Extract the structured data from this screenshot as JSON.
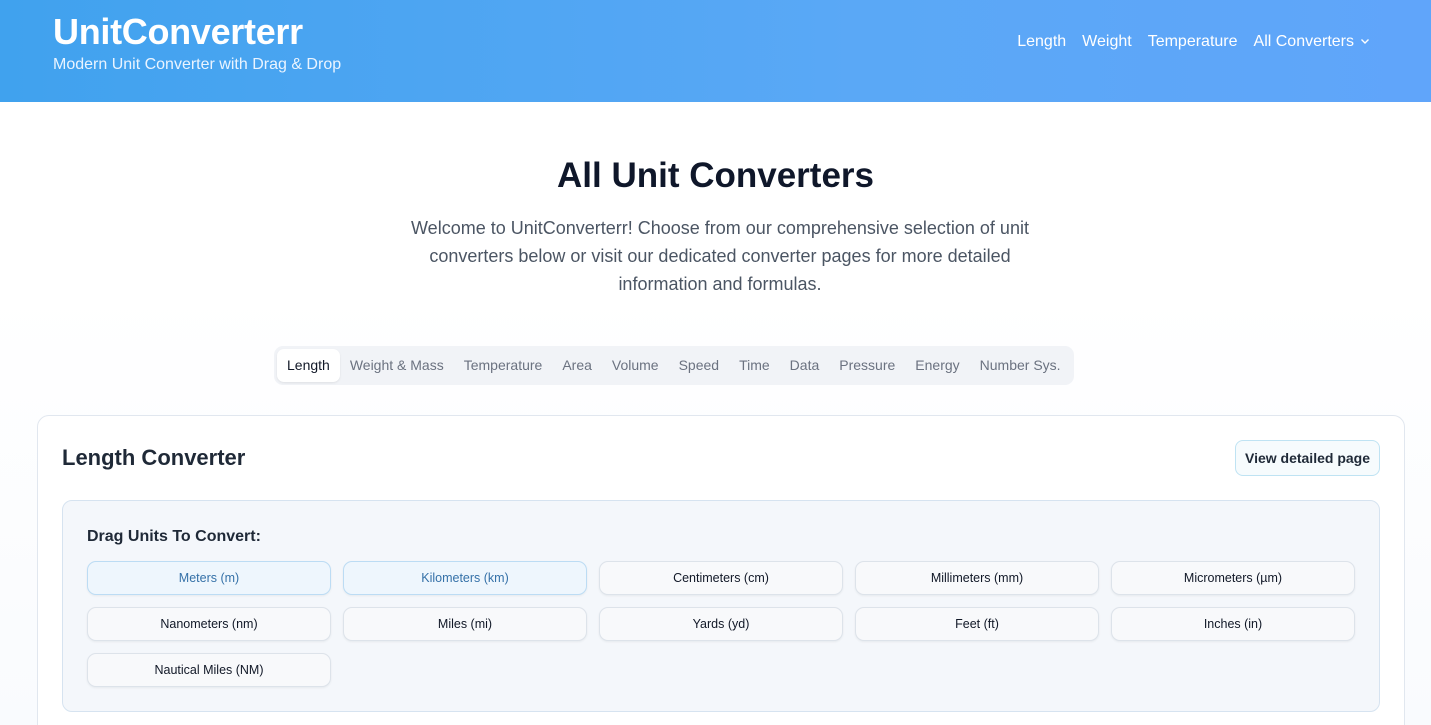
{
  "header": {
    "brand_title": "UnitConverterr",
    "tagline": "Modern Unit Converter with Drag & Drop",
    "nav": [
      "Length",
      "Weight",
      "Temperature",
      "All Converters"
    ],
    "dropdown_icon": "chevron-down-icon"
  },
  "main": {
    "title": "All Unit Converters",
    "intro": "Welcome to UnitConverterr! Choose from our comprehensive selection of unit converters below or visit our dedicated converter pages for more detailed information and formulas.",
    "tabs": [
      "Length",
      "Weight & Mass",
      "Temperature",
      "Area",
      "Volume",
      "Speed",
      "Time",
      "Data",
      "Pressure",
      "Energy",
      "Number Sys."
    ],
    "active_tab": "Length"
  },
  "converter": {
    "title": "Length Converter",
    "detail_button": "View detailed page",
    "drag_label": "Drag Units To Convert:",
    "units": [
      {
        "label": "Meters (m)",
        "selected": true
      },
      {
        "label": "Kilometers (km)",
        "selected": true
      },
      {
        "label": "Centimeters (cm)",
        "selected": false
      },
      {
        "label": "Millimeters (mm)",
        "selected": false
      },
      {
        "label": "Micrometers (µm)",
        "selected": false
      },
      {
        "label": "Nanometers (nm)",
        "selected": false
      },
      {
        "label": "Miles (mi)",
        "selected": false
      },
      {
        "label": "Yards (yd)",
        "selected": false
      },
      {
        "label": "Feet (ft)",
        "selected": false
      },
      {
        "label": "Inches (in)",
        "selected": false
      },
      {
        "label": "Nautical Miles (NM)",
        "selected": false
      }
    ]
  },
  "colors": {
    "header_start": "#40a2ee",
    "header_end": "#60a5fa",
    "selected_chip_bg": "#eef6fd",
    "selected_chip_text": "#3571a8"
  }
}
